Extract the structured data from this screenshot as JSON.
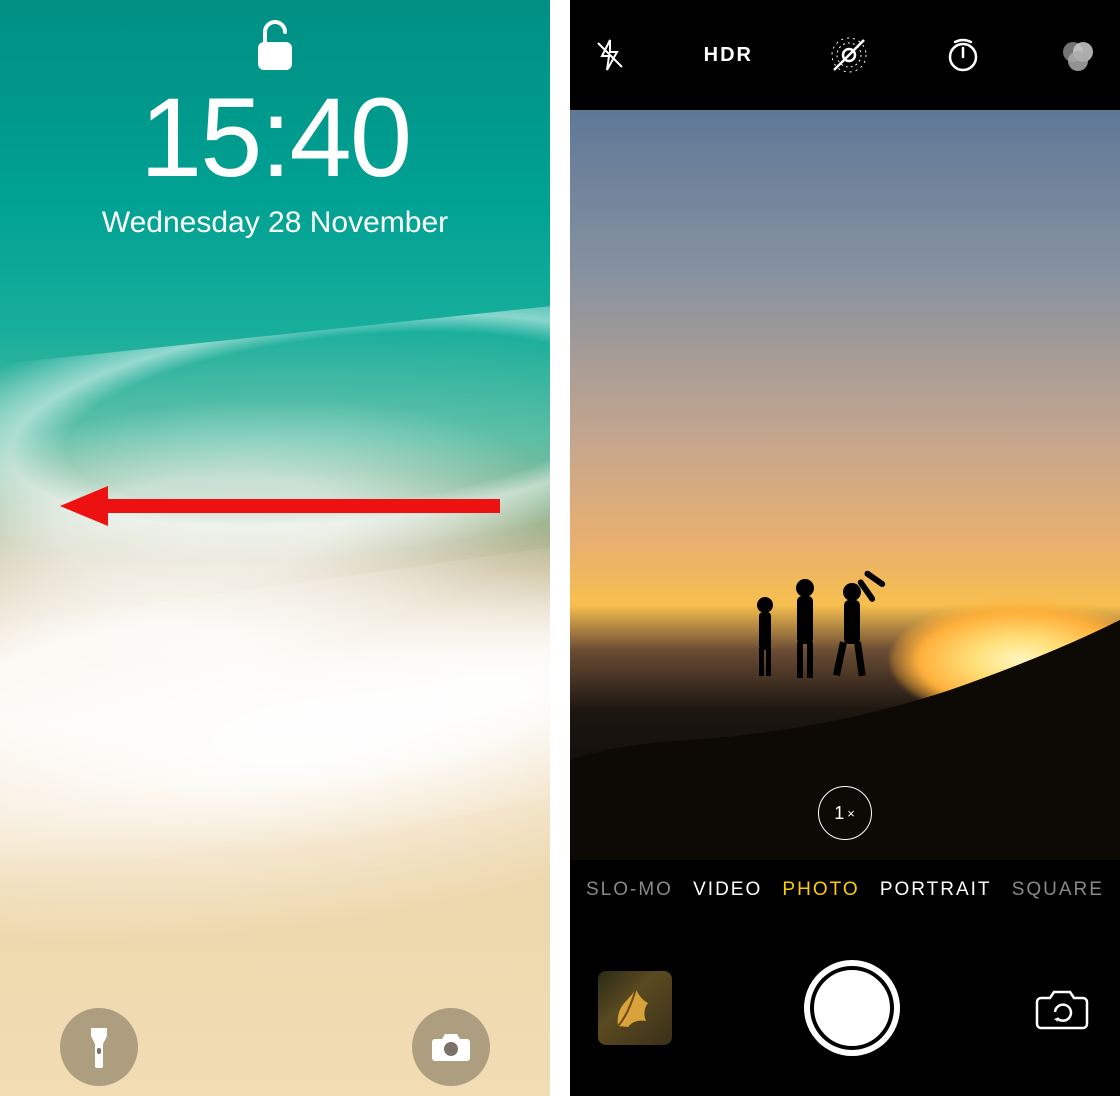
{
  "lockscreen": {
    "time": "15:40",
    "date": "Wednesday 28 November",
    "lock_icon": "unlocked",
    "buttons": {
      "flashlight": "flashlight-icon",
      "camera": "camera-icon"
    },
    "annotation": {
      "type": "swipe-left-arrow",
      "color": "#e11"
    }
  },
  "camera": {
    "topbar": {
      "flash": "off",
      "hdr_label": "HDR",
      "live_photo": "off",
      "timer": "timer-icon",
      "filters": "filters-icon"
    },
    "zoom_label": "1",
    "zoom_suffix": "×",
    "modes": [
      {
        "label": "SLO-MO",
        "state": "dim"
      },
      {
        "label": "VIDEO",
        "state": "normal"
      },
      {
        "label": "PHOTO",
        "state": "active"
      },
      {
        "label": "PORTRAIT",
        "state": "normal"
      },
      {
        "label": "SQUARE",
        "state": "dim"
      }
    ],
    "bottom": {
      "thumbnail": "last-photo-thumbnail",
      "shutter": "shutter-button",
      "flip": "switch-camera-icon"
    }
  }
}
